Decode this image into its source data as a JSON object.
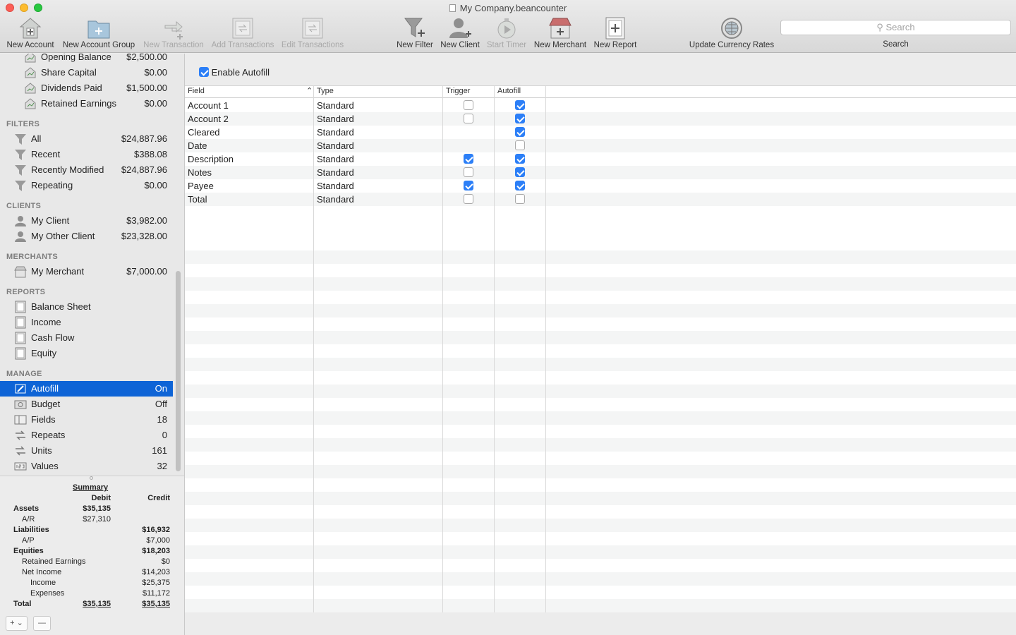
{
  "window": {
    "title": "My Company.beancounter"
  },
  "toolbar": [
    {
      "label": "New Account",
      "icon": "new-account-icon",
      "enabled": true
    },
    {
      "label": "New Account Group",
      "icon": "new-account-group-icon",
      "enabled": true
    },
    {
      "label": "New Transaction",
      "icon": "new-transaction-icon",
      "enabled": false
    },
    {
      "label": "Add Transactions",
      "icon": "add-transactions-icon",
      "enabled": false
    },
    {
      "label": "Edit Transactions",
      "icon": "edit-transactions-icon",
      "enabled": false
    },
    {
      "label": "New Filter",
      "icon": "new-filter-icon",
      "enabled": true
    },
    {
      "label": "New Client",
      "icon": "new-client-icon",
      "enabled": true
    },
    {
      "label": "Start Timer",
      "icon": "start-timer-icon",
      "enabled": false
    },
    {
      "label": "New Merchant",
      "icon": "new-merchant-icon",
      "enabled": true
    },
    {
      "label": "New Report",
      "icon": "new-report-icon",
      "enabled": true
    },
    {
      "label": "Update Currency Rates",
      "icon": "globe-icon",
      "enabled": true
    }
  ],
  "search": {
    "placeholder": "Search",
    "label": "Search"
  },
  "sidebar": {
    "equity_items": [
      {
        "name": "Opening Balance",
        "value": "$2,500.00"
      },
      {
        "name": "Share Capital",
        "value": "$0.00"
      },
      {
        "name": "Dividends Paid",
        "value": "$1,500.00"
      },
      {
        "name": "Retained Earnings",
        "value": "$0.00"
      }
    ],
    "filters_header": "FILTERS",
    "filters": [
      {
        "name": "All",
        "value": "$24,887.96"
      },
      {
        "name": "Recent",
        "value": "$388.08"
      },
      {
        "name": "Recently Modified",
        "value": "$24,887.96"
      },
      {
        "name": "Repeating",
        "value": "$0.00"
      }
    ],
    "clients_header": "CLIENTS",
    "clients": [
      {
        "name": "My Client",
        "value": "$3,982.00"
      },
      {
        "name": "My Other Client",
        "value": "$23,328.00"
      }
    ],
    "merchants_header": "MERCHANTS",
    "merchants": [
      {
        "name": "My Merchant",
        "value": "$7,000.00"
      }
    ],
    "reports_header": "REPORTS",
    "reports": [
      {
        "name": "Balance Sheet"
      },
      {
        "name": "Income"
      },
      {
        "name": "Cash Flow"
      },
      {
        "name": "Equity"
      }
    ],
    "manage_header": "MANAGE",
    "manage": [
      {
        "name": "Autofill",
        "value": "On",
        "selected": true
      },
      {
        "name": "Budget",
        "value": "Off"
      },
      {
        "name": "Fields",
        "value": "18"
      },
      {
        "name": "Repeats",
        "value": "0"
      },
      {
        "name": "Units",
        "value": "161"
      },
      {
        "name": "Values",
        "value": "32"
      }
    ]
  },
  "summary": {
    "title": "Summary",
    "debit_header": "Debit",
    "credit_header": "Credit",
    "rows": [
      {
        "label": "Assets",
        "debit": "$35,135",
        "credit": "",
        "level": 0,
        "bold": true
      },
      {
        "label": "A/R",
        "debit": "$27,310",
        "credit": "",
        "level": 1
      },
      {
        "label": "Liabilities",
        "debit": "",
        "credit": "$16,932",
        "level": 0,
        "bold": true
      },
      {
        "label": "A/P",
        "debit": "",
        "credit": "$7,000",
        "level": 1
      },
      {
        "label": "Equities",
        "debit": "",
        "credit": "$18,203",
        "level": 0,
        "bold": true
      },
      {
        "label": "Retained Earnings",
        "debit": "",
        "credit": "$0",
        "level": 1
      },
      {
        "label": "Net Income",
        "debit": "",
        "credit": "$14,203",
        "level": 1
      },
      {
        "label": "Income",
        "debit": "",
        "credit": "$25,375",
        "level": 2
      },
      {
        "label": "Expenses",
        "debit": "",
        "credit": "$11,172",
        "level": 2
      },
      {
        "label": "Total",
        "debit": "$35,135",
        "credit": "$35,135",
        "level": 0,
        "bold": true
      }
    ]
  },
  "footer": {
    "add_label": "+ ⌄",
    "remove_label": "—"
  },
  "autofill": {
    "enable_label": "Enable Autofill",
    "enabled": true,
    "columns": {
      "field": "Field",
      "type": "Type",
      "trigger": "Trigger",
      "autofill": "Autofill"
    },
    "rows": [
      {
        "field": "Account 1",
        "type": "Standard",
        "trigger": false,
        "autofill": true
      },
      {
        "field": "Account 2",
        "type": "Standard",
        "trigger": false,
        "autofill": true
      },
      {
        "field": "Cleared",
        "type": "Standard",
        "trigger": null,
        "autofill": true
      },
      {
        "field": "Date",
        "type": "Standard",
        "trigger": null,
        "autofill": false
      },
      {
        "field": "Description",
        "type": "Standard",
        "trigger": true,
        "autofill": true
      },
      {
        "field": "Notes",
        "type": "Standard",
        "trigger": false,
        "autofill": true
      },
      {
        "field": "Payee",
        "type": "Standard",
        "trigger": true,
        "autofill": true
      },
      {
        "field": "Total",
        "type": "Standard",
        "trigger": false,
        "autofill": false
      }
    ]
  }
}
